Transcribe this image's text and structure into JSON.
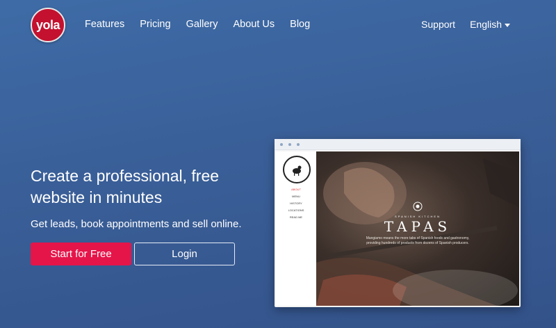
{
  "nav": {
    "logo_text": "yola",
    "links": [
      "Features",
      "Pricing",
      "Gallery",
      "About Us",
      "Blog"
    ],
    "support": "Support",
    "language": "English"
  },
  "hero": {
    "title": "Create a professional, free website in minutes",
    "subtitle": "Get leads, book appointments and sell online.",
    "cta_primary": "Start for Free",
    "cta_secondary": "Login"
  },
  "preview": {
    "menu": [
      "ABOUT",
      "MENU",
      "HISTORY",
      "LOCATIONS",
      "READ ME"
    ],
    "caption_sub": "SPANISH KITCHEN",
    "caption_title": "TAPAS",
    "caption_desc": "Mangiamo means the more tabs of Spanish foods and gastronomy, providing hundreds of products from dozens of Spanish producers."
  },
  "colors": {
    "brand": "#c4112f",
    "cta": "#e5154a",
    "background": "#3a5f98"
  }
}
